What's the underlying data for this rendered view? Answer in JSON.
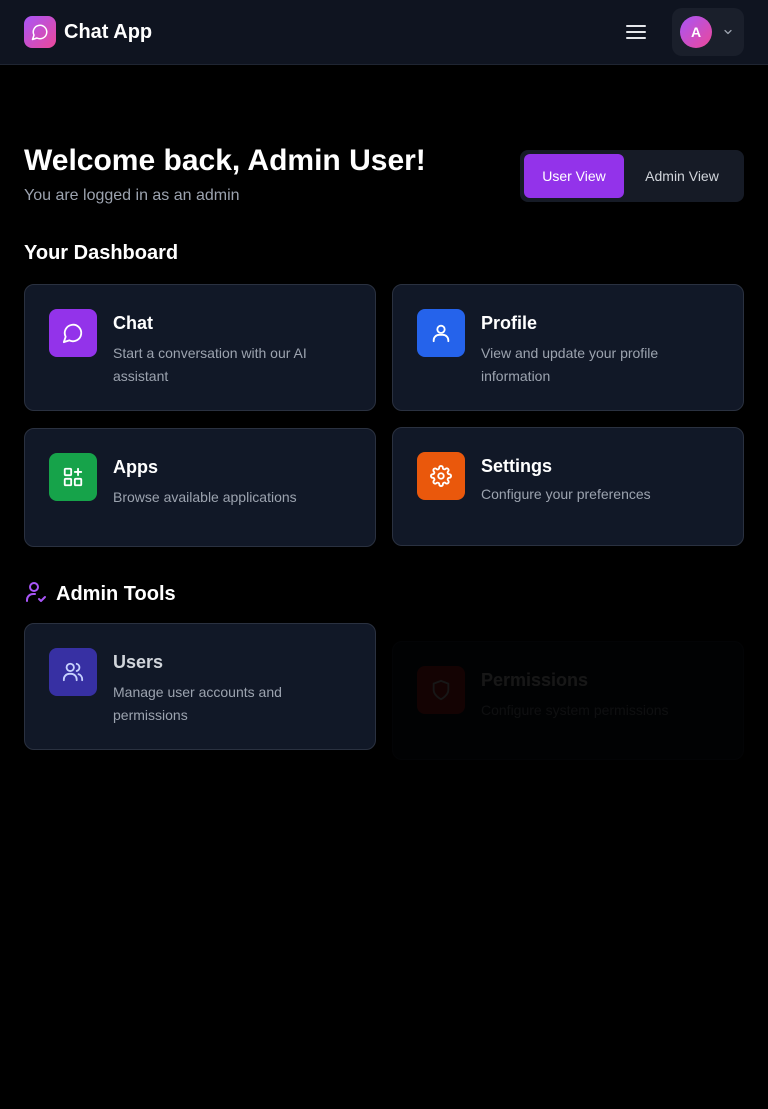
{
  "app": {
    "name": "Chat App"
  },
  "user": {
    "avatar_initial": "A"
  },
  "welcome": {
    "title": "Welcome back, Admin User!",
    "subtitle": "You are logged in as an admin"
  },
  "view_toggle": {
    "user_view_label": "User View",
    "admin_view_label": "Admin View",
    "selected": "User View"
  },
  "dashboard": {
    "title": "Your Dashboard",
    "cards": [
      {
        "title": "Chat",
        "description": "Start a conversation with our AI assistant",
        "icon": "message-circle-icon",
        "color": "#9333ea"
      },
      {
        "title": "Profile",
        "description": "View and update your profile information",
        "icon": "user-icon",
        "color": "#2563eb"
      },
      {
        "title": "Apps",
        "description": "Browse available applications",
        "icon": "apps-grid-icon",
        "color": "#16a34a"
      },
      {
        "title": "Settings",
        "description": "Configure your preferences",
        "icon": "settings-gear-icon",
        "color": "#ea580c"
      }
    ]
  },
  "admin_tools": {
    "title": "Admin Tools",
    "icon": "user-check-icon",
    "cards": [
      {
        "title": "Users",
        "description": "Manage user accounts and permissions",
        "icon": "users-icon",
        "color": "#3730a3"
      },
      {
        "title": "Permissions",
        "description": "Configure system permissions",
        "icon": "shield-icon",
        "color": "#dc2626"
      }
    ]
  },
  "colors": {
    "accent": "#9333ea",
    "background": "#000000",
    "navbar": "#0f1420",
    "card": "#111827",
    "muted_text": "#9ca3af"
  }
}
